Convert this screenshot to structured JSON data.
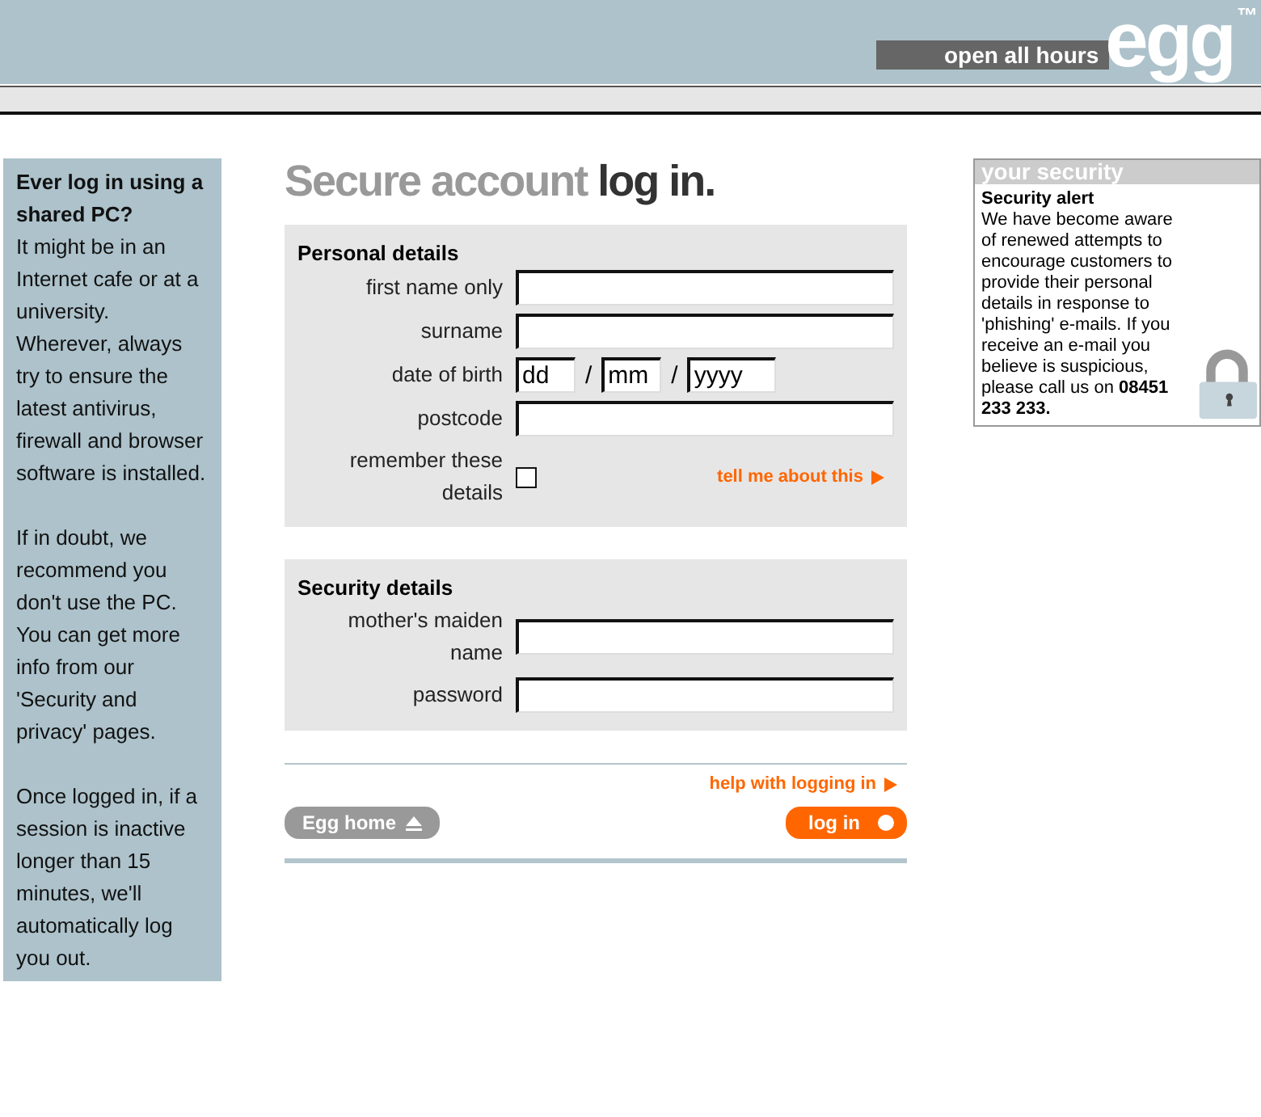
{
  "header": {
    "tagline": "open all hours",
    "logo": "egg",
    "trademark": "™"
  },
  "sidebar": {
    "heading": "Ever log in using a shared PC?",
    "paragraphs": [
      "It might be in an Internet cafe or at a university. Wherever, always try to ensure the latest antivirus, firewall and browser software is installed.",
      "If in doubt, we recommend you don't use the PC. You can get more info from our 'Security and privacy' pages.",
      "Once logged in, if a session is inactive longer than 15 minutes, we'll automatically log you out."
    ]
  },
  "title": {
    "light": "Secure account",
    "dark": "log in."
  },
  "sections": [
    {
      "heading": "Personal details",
      "rows": [
        {
          "kind": "text",
          "label": "first name only"
        },
        {
          "kind": "text",
          "label": "surname"
        },
        {
          "kind": "date",
          "label": "date of birth",
          "parts": [
            "dd",
            "mm",
            "yyyy"
          ],
          "separator": "/"
        },
        {
          "kind": "text",
          "label": "postcode"
        },
        {
          "kind": "checkbox",
          "label": "remember these details",
          "checked": false,
          "link": "tell me about this"
        }
      ]
    },
    {
      "heading": "Security details",
      "rows": [
        {
          "kind": "text",
          "label": "mother's maiden name"
        },
        {
          "kind": "password",
          "label": "password"
        }
      ]
    }
  ],
  "help_link": "help with logging in",
  "buttons": {
    "home": "Egg home",
    "login": "log in"
  },
  "security_box": {
    "title": "your security",
    "heading": "Security alert",
    "body": "We have become aware of renewed attempts to encourage customers to provide their personal details in response to 'phishing' e-mails. If you receive an e-mail you believe is suspicious, please call us on **08451 233 233.**"
  }
}
